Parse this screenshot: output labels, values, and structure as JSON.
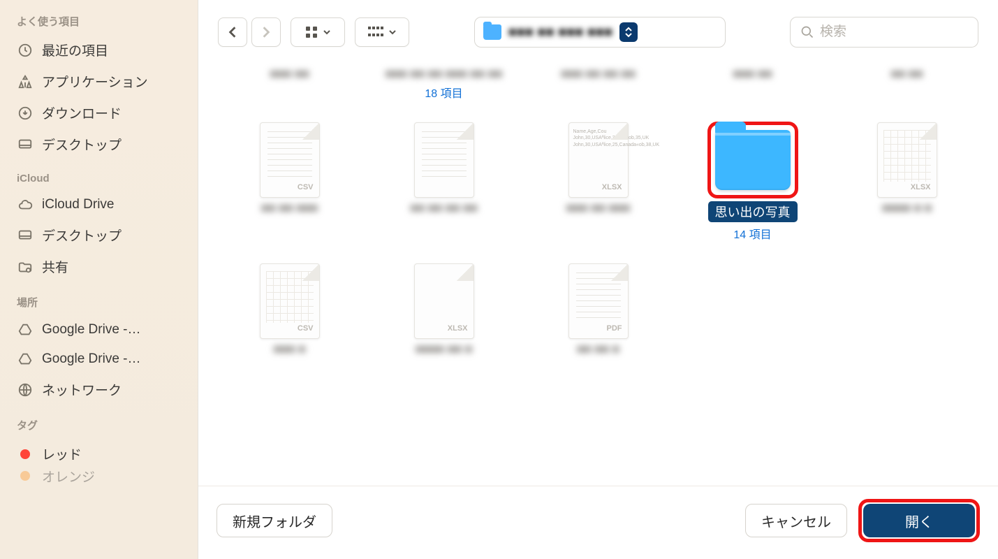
{
  "sidebar": {
    "sections": [
      {
        "heading": "よく使う項目",
        "items": [
          {
            "label": "最近の項目",
            "icon": "clock"
          },
          {
            "label": "アプリケーション",
            "icon": "apps"
          },
          {
            "label": "ダウンロード",
            "icon": "download"
          },
          {
            "label": "デスクトップ",
            "icon": "desktop"
          }
        ]
      },
      {
        "heading": "iCloud",
        "items": [
          {
            "label": "iCloud Drive",
            "icon": "cloud"
          },
          {
            "label": "デスクトップ",
            "icon": "desktop"
          },
          {
            "label": "共有",
            "icon": "shared"
          }
        ]
      },
      {
        "heading": "場所",
        "items": [
          {
            "label": "Google Drive -…",
            "icon": "gdrive"
          },
          {
            "label": "Google Drive -…",
            "icon": "gdrive"
          },
          {
            "label": "ネットワーク",
            "icon": "network"
          }
        ]
      },
      {
        "heading": "タグ",
        "items": [
          {
            "label": "レッド",
            "icon": "tag",
            "color": "#ff4438"
          },
          {
            "label": "オレンジ",
            "icon": "tag",
            "color": "#ff9a2e"
          }
        ]
      }
    ]
  },
  "toolbar": {
    "path_text": "■■■ ■■ ■■■ ■■■",
    "search_placeholder": "検索"
  },
  "files": {
    "row1": [
      {
        "label": "■■■ ■■",
        "sub": ""
      },
      {
        "label": "■■■ ■■ ■■\n■■■ ■■ ■■",
        "sub": "18 項目"
      },
      {
        "label": "■■■ ■■ ■■\n■■",
        "sub": ""
      },
      {
        "label": "■■■ ■■",
        "sub": ""
      },
      {
        "label": "■■\n■■",
        "sub": ""
      }
    ],
    "row2": [
      {
        "type": "csv",
        "label": "■■ ■■ ■■■"
      },
      {
        "type": "text",
        "label": "■■ ■■ ■■ ■■"
      },
      {
        "type": "xlsx-csv",
        "label": "■■■ ■■ ■■■"
      },
      {
        "type": "folder",
        "label": "思い出の写真",
        "sub": "14 項目",
        "selected": true,
        "highlighted": true
      },
      {
        "type": "xlsx",
        "label": "■■■■ ■ ■"
      }
    ],
    "row3": [
      {
        "type": "csv",
        "label": "■■■ ■"
      },
      {
        "type": "xlsx-sched",
        "label": "■■■■ ■■ ■"
      },
      {
        "type": "pdf",
        "label": "■■ ■■ ■"
      }
    ]
  },
  "bottom": {
    "new_folder": "新規フォルダ",
    "cancel": "キャンセル",
    "open": "開く"
  }
}
